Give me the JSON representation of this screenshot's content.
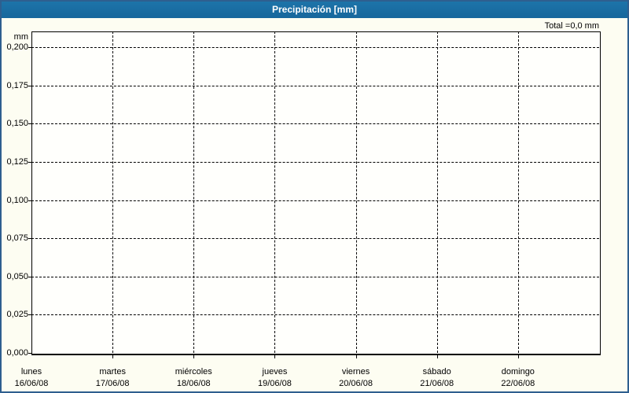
{
  "title": "Precipitación [mm]",
  "total_label": "Total =0,0 mm",
  "chart_data": {
    "type": "bar",
    "title": "Precipitación [mm]",
    "ylabel": "mm",
    "xlabel": "",
    "categories": [
      {
        "day": "lunes",
        "date": "16/06/08"
      },
      {
        "day": "martes",
        "date": "17/06/08"
      },
      {
        "day": "miércoles",
        "date": "18/06/08"
      },
      {
        "day": "jueves",
        "date": "19/06/08"
      },
      {
        "day": "viernes",
        "date": "20/06/08"
      },
      {
        "day": "sábado",
        "date": "21/06/08"
      },
      {
        "day": "domingo",
        "date": "22/06/08"
      }
    ],
    "series": [
      {
        "name": "Precipitación",
        "values": [
          0,
          0,
          0,
          0,
          0,
          0,
          0
        ]
      }
    ],
    "total": "0,0",
    "total_unit": "mm",
    "y_ticks": [
      "0,000",
      "0,025",
      "0,050",
      "0,075",
      "0,100",
      "0,125",
      "0,150",
      "0,175",
      "0,200"
    ],
    "y_tick_values": [
      0,
      0.025,
      0.05,
      0.075,
      0.1,
      0.125,
      0.15,
      0.175,
      0.2
    ],
    "ylim": [
      0,
      0.2104
    ],
    "grid": "dashed",
    "legend": "none"
  },
  "colors": {
    "titlebar_bg": "#17679c",
    "titlebar_text": "#ffffff",
    "frame_border": "#2e5f8f",
    "background": "#fdfdf2",
    "plot_bg": "#fffffc",
    "grid": "#000000",
    "text": "#000000"
  }
}
